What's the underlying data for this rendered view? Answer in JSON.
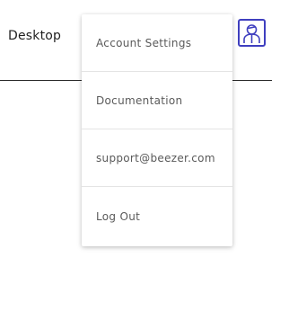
{
  "header": {
    "title": "Desktop"
  },
  "account": {
    "avatar_icon": "user-avatar-icon",
    "accent_color": "#3f3fbf"
  },
  "menu": {
    "items": [
      {
        "label": "Account Settings"
      },
      {
        "label": "Documentation"
      },
      {
        "label": "support@beezer.com"
      },
      {
        "label": "Log Out"
      }
    ]
  }
}
